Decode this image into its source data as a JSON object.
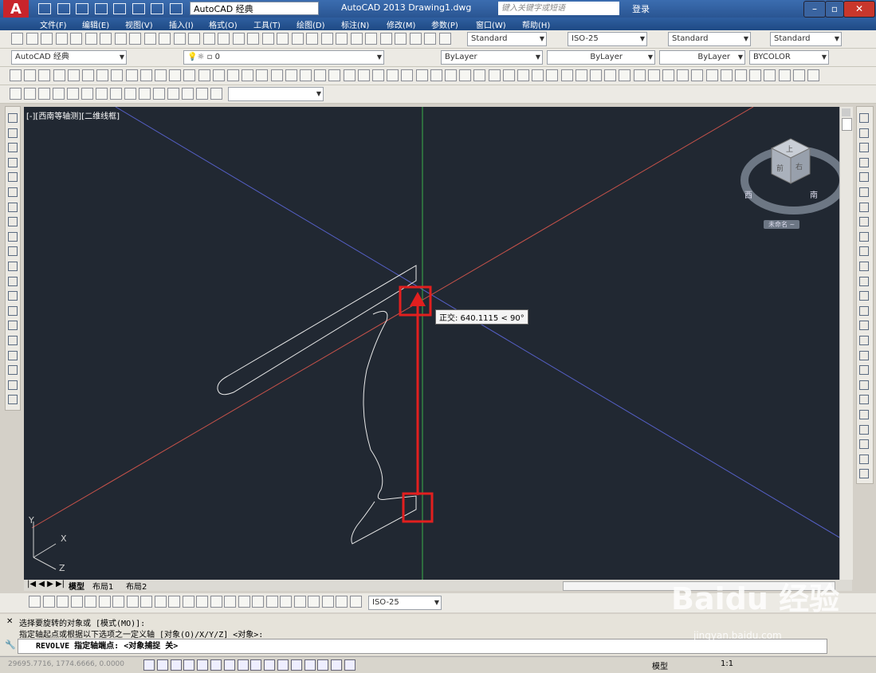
{
  "app": {
    "logo_letter": "A",
    "workspace": "AutoCAD 经典",
    "title": "AutoCAD 2013    Drawing1.dwg",
    "search_placeholder": "键入关键字或短语",
    "login": "登录"
  },
  "menu": [
    "文件(F)",
    "编辑(E)",
    "视图(V)",
    "插入(I)",
    "格式(O)",
    "工具(T)",
    "绘图(D)",
    "标注(N)",
    "修改(M)",
    "参数(P)",
    "窗口(W)",
    "帮助(H)"
  ],
  "styles_toolbar": {
    "text_style": "Standard",
    "dim_style": "ISO-25",
    "table_style": "Standard",
    "mleader_style": "Standard"
  },
  "layers_toolbar": {
    "workspace": "AutoCAD 经典",
    "layer": "0",
    "color": "ByLayer",
    "linetype": "ByLayer",
    "lineweight": "ByLayer",
    "plotstyle": "BYCOLOR"
  },
  "viewport": {
    "label": "[-][西南等轴测][二维线框]",
    "tooltip": "正交: 640.1115 < 90°",
    "navcube_faces": [
      "上",
      "前",
      "右"
    ],
    "navcube_compass": [
      "西",
      "南"
    ],
    "navcube_label": "未命名 ~",
    "ucs_labels": [
      "Y",
      "X",
      "Z"
    ]
  },
  "tabs": [
    "模型",
    "布局1",
    "布局2"
  ],
  "dim_toolbar": {
    "dim_style": "ISO-25"
  },
  "command": {
    "line1": "选择要旋转的对象或 [模式(MO)]:",
    "line2": "指定轴起点或根据以下选项之一定义轴 [对象(O)/X/Y/Z] <对象>:",
    "prompt": "REVOLVE 指定轴端点: <对象捕捉 关>"
  },
  "status": {
    "coords": "29695.7716, 1774.6666, 0.0000",
    "model": "模型",
    "scale": "1:1"
  },
  "watermark": {
    "brand": "Baidu 经验",
    "url": "jingyan.baidu.com"
  },
  "colors": {
    "viewport_bg": "#212832",
    "highlight": "#e21f1f",
    "x_axis": "#c8524a",
    "y_axis": "#5660c8",
    "z_axis": "#3ab04a"
  }
}
